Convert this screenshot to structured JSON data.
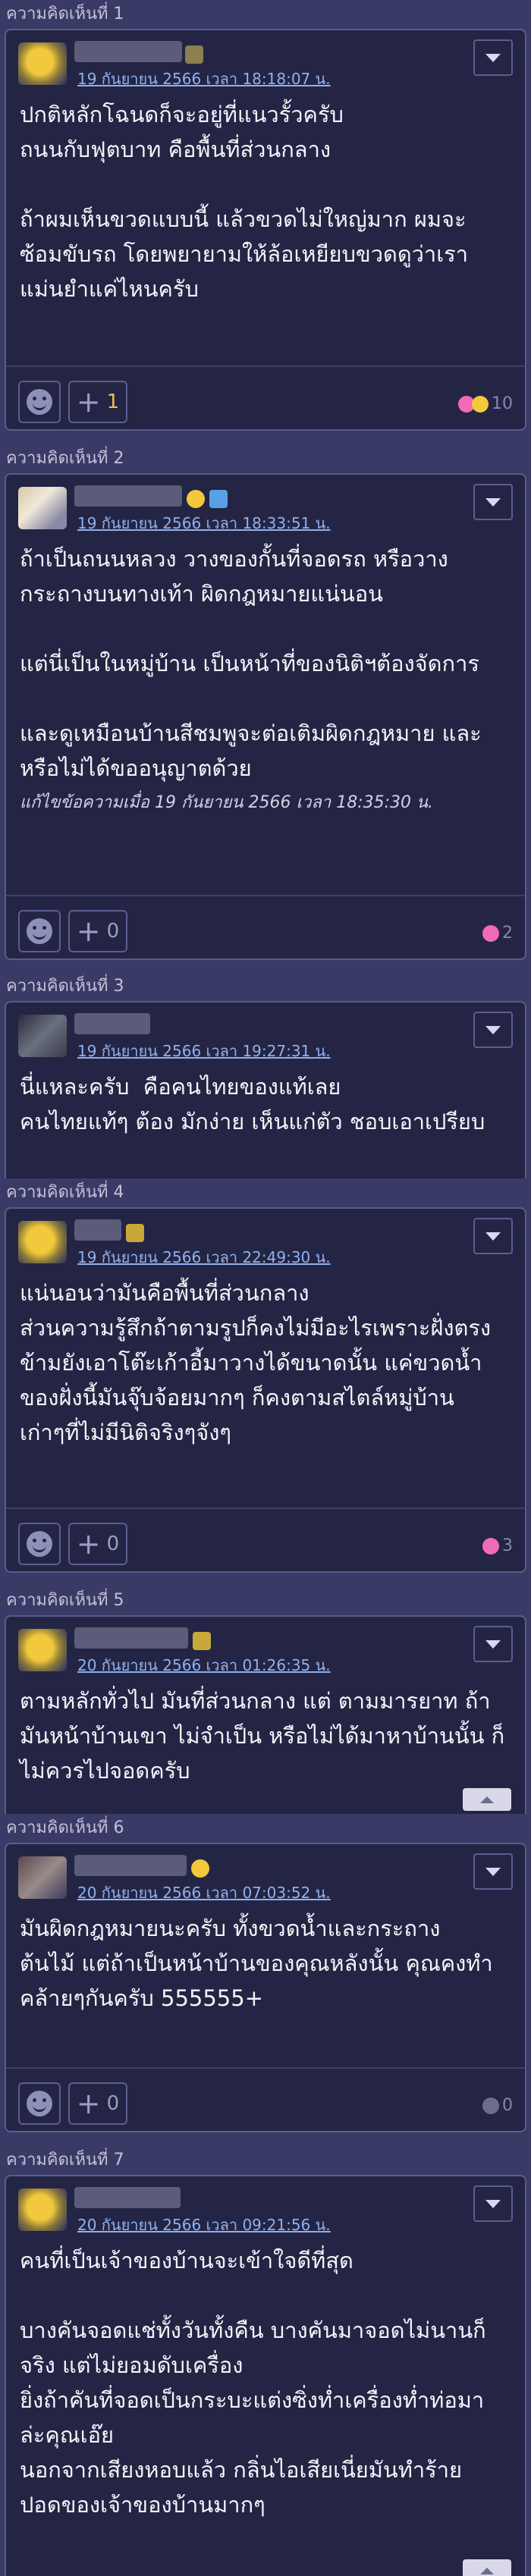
{
  "comments": [
    {
      "label": "ความคิดเห็นที่ 1",
      "time": "19 กันยายน 2566 เวลา 18:18:07 น.",
      "body": "ปกติหลักโฉนดก็จะอยู่ที่แนวรั้วครับ\nถนนกับฟุตบาท คือพื้นที่ส่วนกลาง\n\nถ้าผมเห็นขวดแบบนี้ แล้วขวดไม่ใหญ่มาก ผมจะ\nซ้อมขับรถ โดยพยายามให้ล้อเหยียบขวดดูว่าเรา\nแม่นยำแค่ไหนครับ",
      "plus": "1",
      "reactions": "10"
    },
    {
      "label": "ความคิดเห็นที่ 2",
      "time": "19 กันยายน 2566 เวลา 18:33:51 น.",
      "body": "ถ้าเป็นถนนหลวง วางของกั้นที่จอดรถ หรือวาง\nกระถางบนทางเท้า ผิดกฎหมายแน่นอน\n\nแต่นี่เป็นในหมู่บ้าน เป็นหน้าที่ของนิติฯต้องจัดการ\n\nและดูเหมือนบ้านสีชมพูจะต่อเติมผิดกฎหมาย และ\nหรือไม่ได้ขออนุญาตด้วย",
      "edited": "แก้ไขข้อความเมื่อ 19 กันยายน 2566 เวลา 18:35:30 น.",
      "plus": "0",
      "reactions": "2"
    },
    {
      "label": "ความคิดเห็นที่ 3",
      "time": "19 กันยายน 2566 เวลา 19:27:31 น.",
      "body": "นี่แหละครับ  คือคนไทยของแท้เลย\nคนไทยแท้ๆ ต้อง มักง่าย เห็นแก่ตัว ชอบเอาเปรียบ"
    },
    {
      "label": "ความคิดเห็นที่ 4",
      "time": "19 กันยายน 2566 เวลา 22:49:30 น.",
      "body": "แน่นอนว่ามันคือพื้นที่ส่วนกลาง\nส่วนความรู้สึกถ้าตามรูปก็คงไม่มีอะไรเพราะฝั่งตรง\nข้ามยังเอาโต๊ะเก้าอี้มาวางได้ขนาดนั้น แค่ขวดน้ำ\nของฝั่งนี้มันจุ๊บจ้อยมากๆ ก็คงตามสไตล์หมู่บ้าน\nเก่าๆที่ไม่มีนิติจริงๆจังๆ",
      "plus": "0",
      "reactions": "3"
    },
    {
      "label": "ความคิดเห็นที่ 5",
      "time": "20 กันยายน 2566 เวลา 01:26:35 น.",
      "body": "ตามหลักทั่วไป มันที่ส่วนกลาง แต่ ตามมารยาท ถ้า\nมันหน้าบ้านเขา ไม่จำเป็น หรือไม่ได้มาหาบ้านนั้น ก็\nไม่ควรไปจอดครับ"
    },
    {
      "label": "ความคิดเห็นที่ 6",
      "time": "20 กันยายน 2566 เวลา 07:03:52 น.",
      "body": "มันผิดกฎหมายนะครับ ทั้งขวดน้ำและกระถาง\nต้นไม้ แต่ถ้าเป็นหน้าบ้านของคุณหลังนั้น คุณคงทำ\nคล้ายๆกันครับ 555555+",
      "plus": "0",
      "reactions": "0"
    },
    {
      "label": "ความคิดเห็นที่ 7",
      "time": "20 กันยายน 2566 เวลา 09:21:56 น.",
      "body": "คนที่เป็นเจ้าของบ้านจะเข้าใจดีที่สุด\n\nบางคันจอดแช่ทั้งวันทั้งคืน บางคันมาจอดไม่นานก็\nจริง แต่ไม่ยอมดับเครื่อง\nยิ่งถ้าคันที่จอดเป็นกระบะแต่งซิ่งท่ำเครื่องท่ำท่อมา\nล่ะคุณเอ๊ย\nนอกจากเสียงหอบแล้ว กลิ่นไอเสียเนี่ยมันทำร้าย\nปอดของเจ้าของบ้านมากๆ"
    }
  ],
  "colors": {
    "background": "#3a3a66",
    "card": "#242544",
    "border": "#5a5c8c",
    "link": "#8fb0ee",
    "heart": "#f06bb4"
  }
}
